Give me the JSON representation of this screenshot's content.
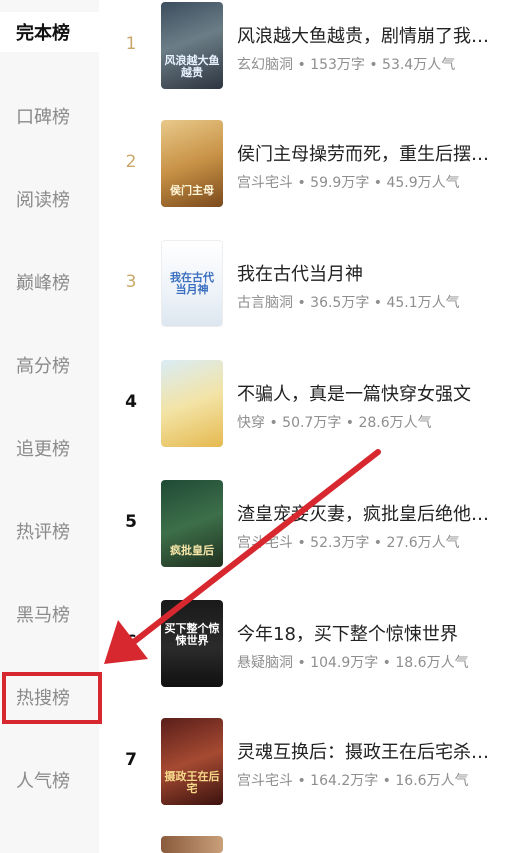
{
  "sidebar": {
    "items": [
      {
        "label": "完本榜"
      },
      {
        "label": "口碑榜"
      },
      {
        "label": "阅读榜"
      },
      {
        "label": "巅峰榜"
      },
      {
        "label": "高分榜"
      },
      {
        "label": "追更榜"
      },
      {
        "label": "热评榜"
      },
      {
        "label": "黑马榜"
      },
      {
        "label": "热搜榜"
      },
      {
        "label": "人气榜"
      }
    ]
  },
  "books": [
    {
      "rank": "1",
      "title": "风浪越大鱼越贵，剧情崩了我…",
      "meta": "玄幻脑洞 • 153万字 • 53.4万人气",
      "cover_text": "风浪越大鱼越贵"
    },
    {
      "rank": "2",
      "title": "侯门主母操劳而死，重生后摆…",
      "meta": "宫斗宅斗 • 59.9万字 • 45.9万人气",
      "cover_text": "侯门主母"
    },
    {
      "rank": "3",
      "title": "我在古代当月神",
      "meta": "古言脑洞 • 36.5万字 • 45.1万人气",
      "cover_text": "我在古代当月神"
    },
    {
      "rank": "4",
      "title": "不骗人，真是一篇快穿女强文",
      "meta": "快穿 • 50.7万字 • 28.6万人气",
      "cover_text": ""
    },
    {
      "rank": "5",
      "title": "渣皇宠妾灭妻，疯批皇后绝他…",
      "meta": "宫斗宅斗 • 52.3万字 • 27.6万人气",
      "cover_text": "疯批皇后"
    },
    {
      "rank": "6",
      "title": "今年18，买下整个惊悚世界",
      "meta": "悬疑脑洞 • 104.9万字 • 18.6万人气",
      "cover_text": "买下整个惊悚世界"
    },
    {
      "rank": "7",
      "title": "灵魂互换后：摄政王在后宅杀…",
      "meta": "宫斗宅斗 • 164.2万字 • 16.6万人气",
      "cover_text": "摄政王在后宅"
    }
  ],
  "colors": {
    "accent_red": "#d8282f",
    "rank_gold": "#c9a86a",
    "sidebar_bg": "#f7f7f7"
  }
}
